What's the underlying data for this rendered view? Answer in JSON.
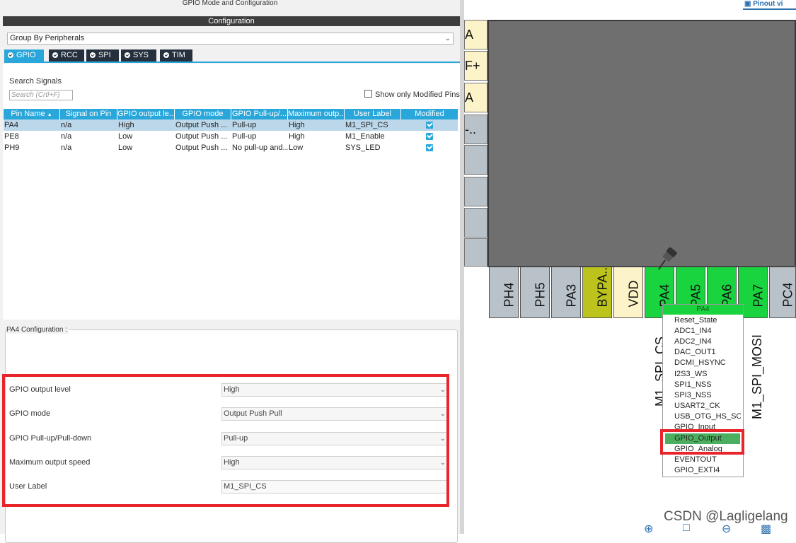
{
  "window": {
    "title": "GPIO Mode and Configuration",
    "configuration_header": "Configuration"
  },
  "group_select": {
    "value": "Group By Peripherals"
  },
  "tabs": [
    {
      "label": "GPIO",
      "active": true
    },
    {
      "label": "RCC"
    },
    {
      "label": "SPI"
    },
    {
      "label": "SYS"
    },
    {
      "label": "TIM"
    }
  ],
  "search": {
    "label": "Search Signals",
    "placeholder": "Search (Crtl+F)"
  },
  "show_modified": {
    "label": "Show only Modified Pins",
    "checked": false
  },
  "table": {
    "headers": [
      "Pin Name",
      "Signal on Pin",
      "GPIO output le...",
      "GPIO mode",
      "GPIO Pull-up/...",
      "Maximum outp...",
      "User Label",
      "Modified"
    ],
    "rows": [
      {
        "pin": "PA4",
        "signal": "n/a",
        "level": "High",
        "mode": "Output Push ...",
        "pull": "Pull-up",
        "speed": "High",
        "label": "M1_SPI_CS",
        "modified": true,
        "selected": true
      },
      {
        "pin": "PE8",
        "signal": "n/a",
        "level": "Low",
        "mode": "Output Push ...",
        "pull": "Pull-up",
        "speed": "High",
        "label": "M1_Enable",
        "modified": true
      },
      {
        "pin": "PH9",
        "signal": "n/a",
        "level": "Low",
        "mode": "Output Push ...",
        "pull": "No pull-up and...",
        "speed": "Low",
        "label": "SYS_LED",
        "modified": true
      }
    ]
  },
  "pin_config": {
    "group_label": "PA4 Configuration :",
    "fields": [
      {
        "label": "GPIO output level",
        "value": "High"
      },
      {
        "label": "GPIO mode",
        "value": "Output Push Pull"
      },
      {
        "label": "GPIO Pull-up/Pull-down",
        "value": "Pull-up"
      },
      {
        "label": "Maximum output speed",
        "value": "High"
      },
      {
        "label": "User Label",
        "value": "M1_SPI_CS"
      }
    ]
  },
  "pinout": {
    "tab_label": "Pinout vi",
    "left_pins": [
      "A",
      "F+",
      "A",
      "-.."
    ],
    "bottom_pins": [
      "PH4",
      "PH5",
      "PA3",
      "BYPA...",
      "VDD",
      "PA4",
      "PA5",
      "PA6",
      "PA7",
      "PC4"
    ],
    "signal_labels": [
      "M1_SPI_CS",
      "M1_SPI_MOSI"
    ]
  },
  "context_menu": {
    "header": "PA4",
    "items": [
      "Reset_State",
      "ADC1_IN4",
      "ADC2_IN4",
      "DAC_OUT1",
      "DCMI_HSYNC",
      "I2S3_WS",
      "SPI1_NSS",
      "SPI3_NSS",
      "USART2_CK",
      "USB_OTG_HS_SOF",
      "GPIO_Input",
      "GPIO_Output",
      "GPIO_Analog",
      "EVENTOUT",
      "GPIO_EXTI4"
    ],
    "selected": "GPIO_Output"
  },
  "watermark": "CSDN @Lagligelang",
  "colors": {
    "accent": "#2aa7da",
    "highlight_box": "#e8252b",
    "pin_assigned": "#19d43e",
    "pin_power": "#fdf3c8",
    "pin_bypass": "#bcc31d"
  }
}
